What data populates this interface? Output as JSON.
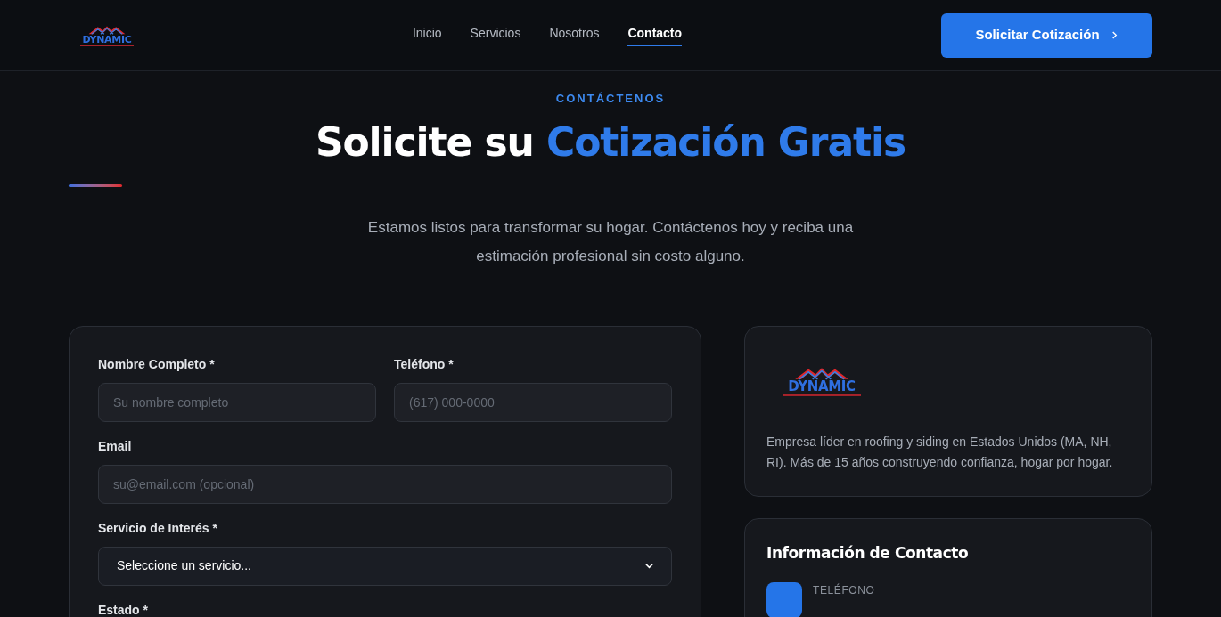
{
  "header": {
    "logo": {
      "name": "DYNAMIC"
    },
    "nav": [
      {
        "label": "Inicio",
        "selected": false
      },
      {
        "label": "Servicios",
        "selected": false
      },
      {
        "label": "Nosotros",
        "selected": false
      },
      {
        "label": "Contacto",
        "selected": true
      }
    ],
    "cta": "Solicitar Cotización"
  },
  "hero": {
    "eyebrow": "CONTÁCTENOS",
    "title": "Solicite su",
    "title_highlight": "Cotización Gratis",
    "subtitle": "Estamos listos para transformar su hogar. Contáctenos hoy y reciba una estimación profesional sin costo alguno."
  },
  "form": {
    "fields": [
      {
        "kind": "input",
        "label": "Nombre Completo *",
        "placeholder": "Su nombre completo"
      },
      {
        "kind": "input",
        "label": "Teléfono *",
        "placeholder": "(617) 000-0000"
      },
      {
        "kind": "input",
        "label": "Email",
        "placeholder": "su@email.com (opcional)",
        "wide": true
      },
      {
        "kind": "select",
        "label": "Servicio de Interés *",
        "value": "Seleccione un servicio...",
        "wide": true
      },
      {
        "kind": "label",
        "label": "Estado *",
        "wide": true
      }
    ]
  },
  "about": {
    "logo": {
      "name": "DYNAMIC"
    },
    "text": "Empresa líder en roofing y siding en Estados Unidos (MA, NH, RI). Más de 15 años construyendo confianza, hogar por hogar."
  },
  "contact_info": {
    "title": "Información de Contacto",
    "items": [
      {
        "label": "TELÉFONO"
      }
    ]
  }
}
